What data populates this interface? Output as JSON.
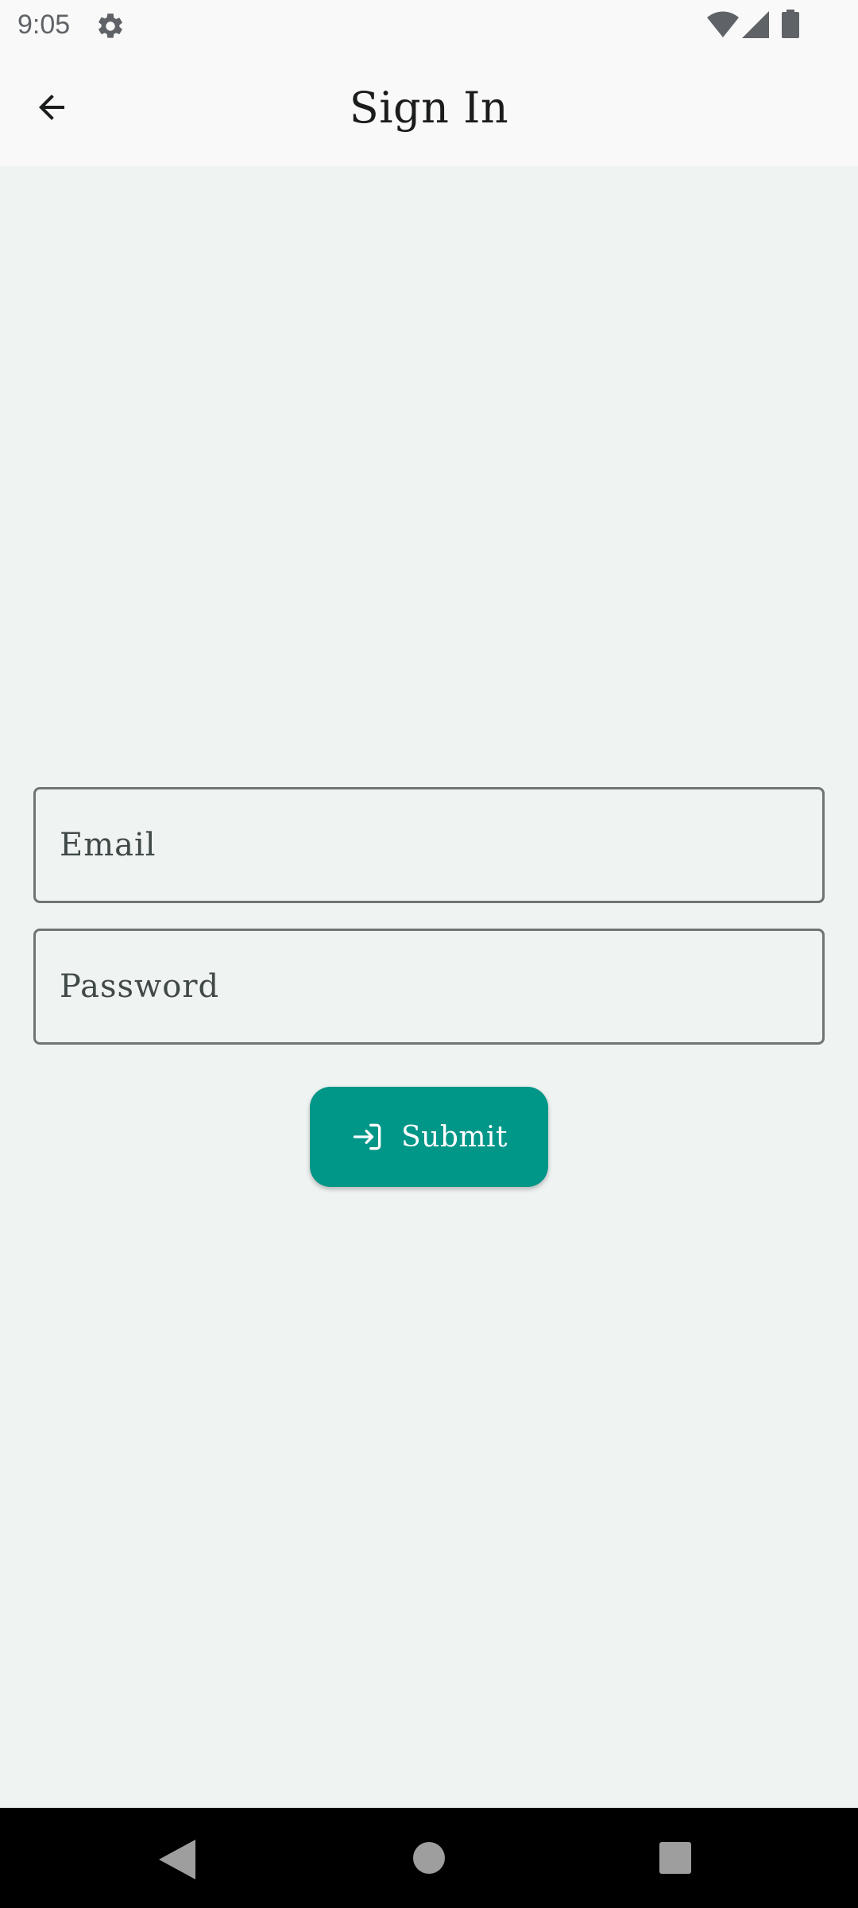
{
  "status_bar": {
    "time": "9:05",
    "icons": [
      "settings-icon",
      "wifi-icon",
      "cell-signal-icon",
      "battery-icon"
    ]
  },
  "app_bar": {
    "title": "Sign In",
    "back_icon": "arrow-left-icon"
  },
  "form": {
    "email": {
      "placeholder": "Email",
      "value": ""
    },
    "password": {
      "placeholder": "Password",
      "value": ""
    },
    "submit": {
      "label": "Submit",
      "icon": "login-icon"
    }
  },
  "nav_bar": {
    "icons": [
      "nav-back-icon",
      "nav-home-icon",
      "nav-recents-icon"
    ]
  },
  "colors": {
    "accent": "#009688",
    "background": "#eff3f2",
    "app_bar": "#f9f9f9",
    "outline": "#6f7574"
  }
}
